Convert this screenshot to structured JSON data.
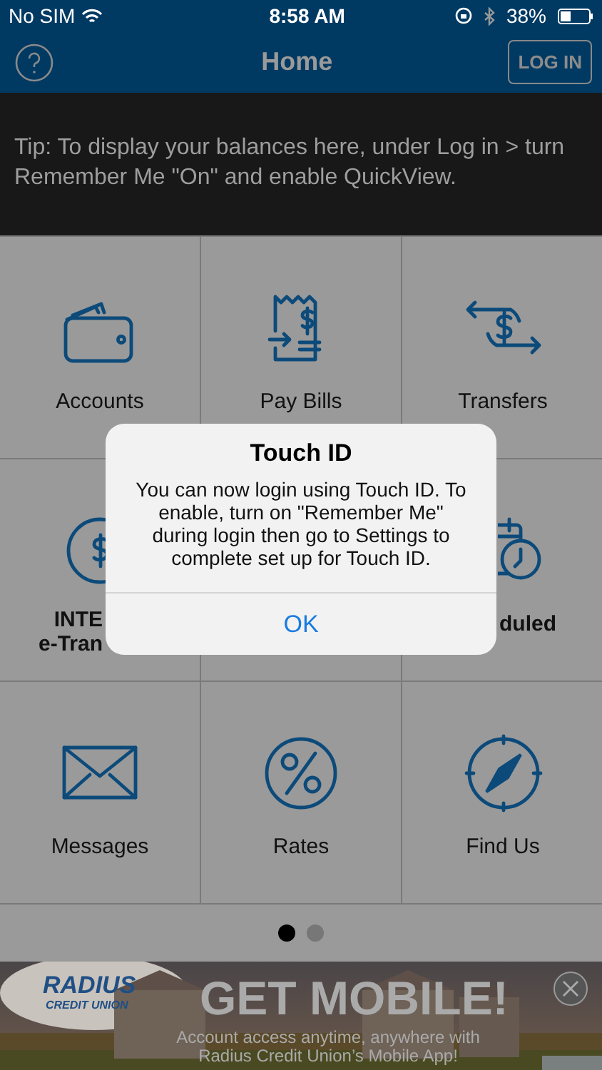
{
  "status_bar": {
    "carrier": "No SIM",
    "time": "8:58 AM",
    "battery": "38%"
  },
  "header": {
    "title": "Home",
    "login_button": "LOG IN"
  },
  "tip": "Tip: To display your balances here, under Log in > turn Remember Me \"On\" and enable QuickView.",
  "tiles": [
    {
      "kind": "full",
      "lines": [
        "Accounts"
      ]
    },
    {
      "kind": "full",
      "lines": [
        "Pay Bills"
      ]
    },
    {
      "kind": "full",
      "lines": [
        "Transfers"
      ]
    },
    {
      "kind": "endcut",
      "lines": [
        "INTE",
        "e-Tran"
      ]
    },
    {
      "kind": "hidden"
    },
    {
      "kind": "startcut",
      "lines": [
        "duled"
      ]
    },
    {
      "kind": "full",
      "lines": [
        "Messages"
      ]
    },
    {
      "kind": "full",
      "lines": [
        "Rates"
      ]
    },
    {
      "kind": "full",
      "lines": [
        "Find Us"
      ]
    }
  ],
  "pager": [
    {
      "selected": true
    },
    {
      "selected": false
    }
  ],
  "banner": {
    "logo": [
      "RADIUS",
      "CREDIT UNION"
    ],
    "headline": "GET MOBILE!",
    "subtitle": [
      "Account access anytime, anywhere with",
      "Radius Credit Union’s Mobile App!"
    ]
  },
  "dialog": {
    "title": "Touch ID",
    "message": "You can now login using Touch ID. To enable, turn on \"Remember Me\" during login then go to Settings to complete set up for Touch ID.",
    "button": "OK"
  }
}
